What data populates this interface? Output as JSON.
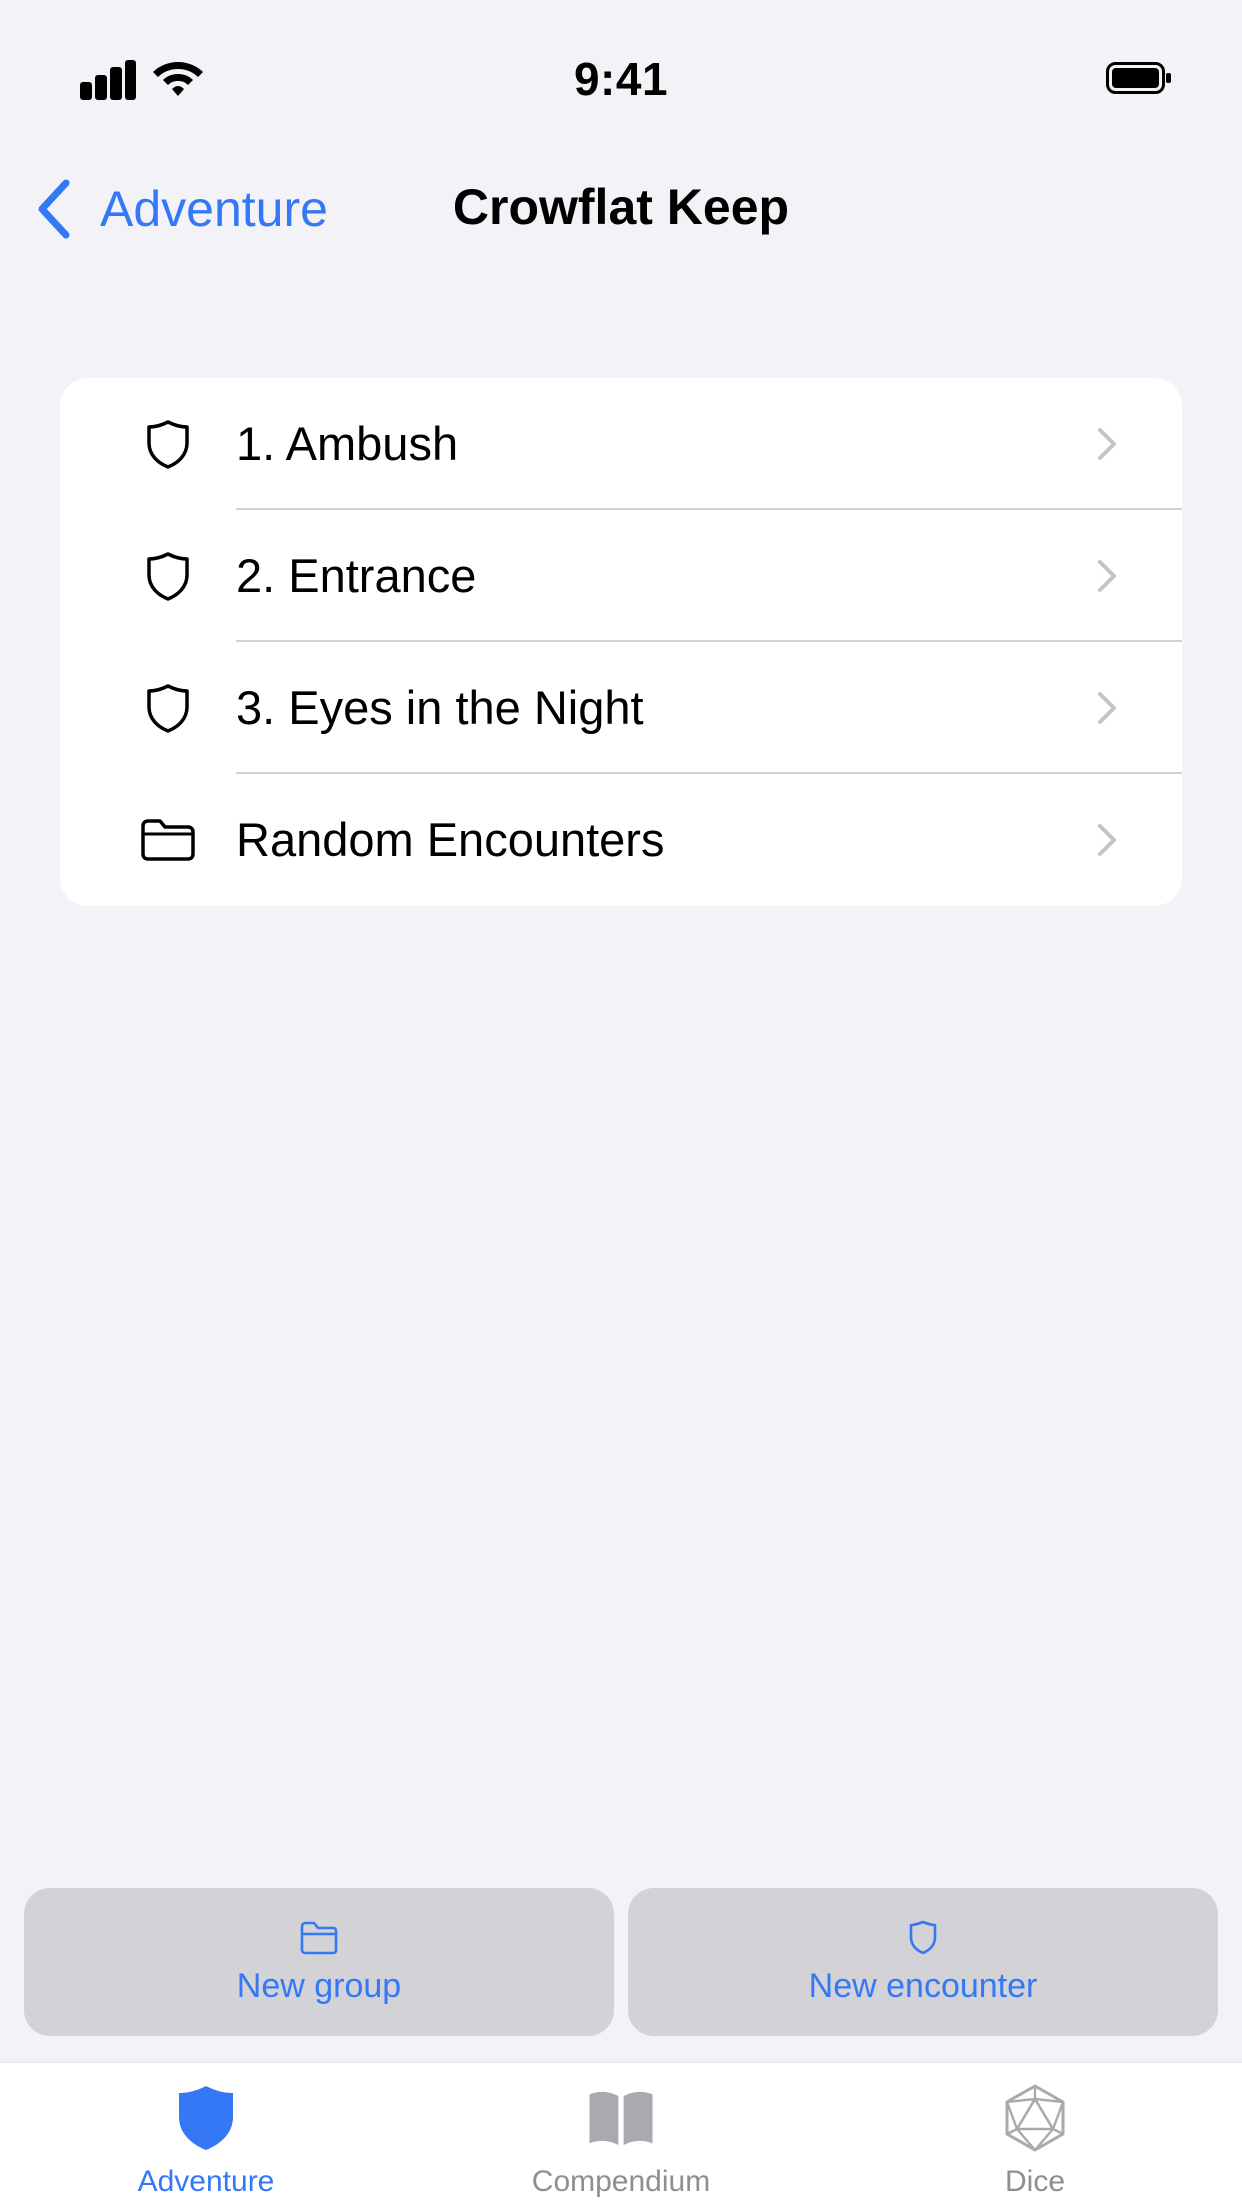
{
  "status_bar": {
    "time": "9:41",
    "icons": [
      "signal-icon",
      "wifi-icon",
      "battery-icon"
    ]
  },
  "nav": {
    "back_label": "Adventure",
    "title": "Crowflat Keep"
  },
  "list": {
    "items": [
      {
        "label": "1. Ambush",
        "icon": "shield-icon"
      },
      {
        "label": "2. Entrance",
        "icon": "shield-icon"
      },
      {
        "label": "3. Eyes in the Night",
        "icon": "shield-icon"
      },
      {
        "label": "Random Encounters",
        "icon": "folder-icon"
      }
    ]
  },
  "actions": {
    "new_group_label": "New group",
    "new_encounter_label": "New encounter"
  },
  "tabs": {
    "items": [
      {
        "label": "Adventure",
        "icon": "shield-filled-icon",
        "active": true
      },
      {
        "label": "Compendium",
        "icon": "book-icon",
        "active": false
      },
      {
        "label": "Dice",
        "icon": "d20-icon",
        "active": false
      }
    ]
  },
  "colors": {
    "background": "#F2F2F7",
    "accent": "#3478F6",
    "card": "#FFFFFF",
    "button": "#D2D2D7",
    "inactive": "#8E8E93"
  }
}
